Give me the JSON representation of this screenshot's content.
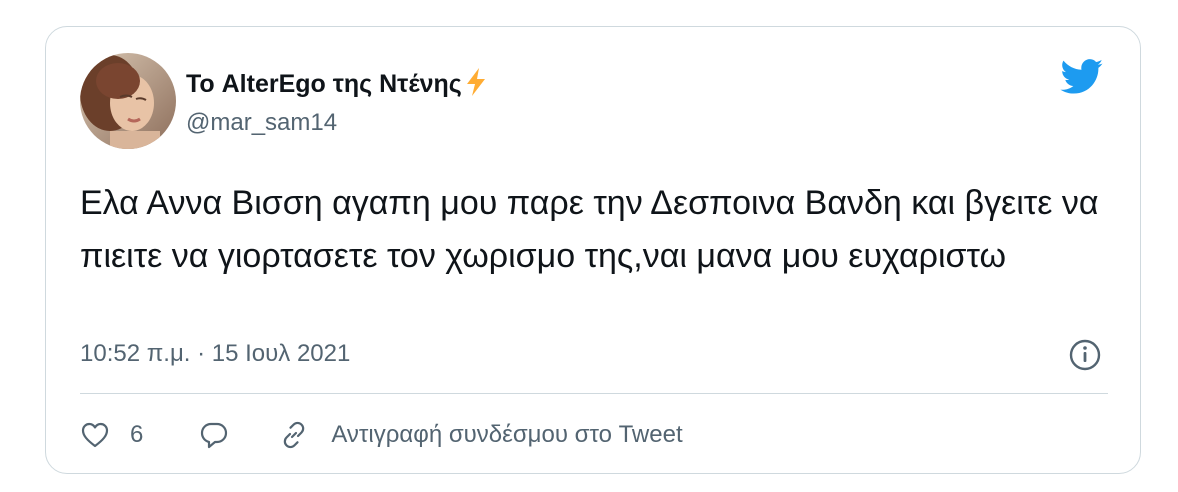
{
  "tweet": {
    "author_name": "Το AlterEgo της Ντένης",
    "handle": "@mar_sam14",
    "text": "Ελα Αννα Βισση αγαπη μου παρε την Δεσποινα Βανδη και βγειτε να πιειτε να γιορτασετε τον χωρισμο της,ναι μανα μου ευχαριστω",
    "timestamp": "10:52 π.μ. · 15 Ιουλ 2021",
    "like_count": "6",
    "copy_link_label": "Αντιγραφή συνδέσμου στο Tweet"
  },
  "icons": {
    "verified_emoji": "lightning-bolt-icon",
    "brand": "twitter-bird-icon",
    "info": "info-icon",
    "like": "heart-icon",
    "reply": "reply-icon",
    "copy_link": "link-icon"
  },
  "colors": {
    "brand_blue": "#1d9bf0",
    "text_primary": "#0f1419",
    "text_secondary": "#536471",
    "border": "#cfd9de",
    "bolt_yellow": "#ffac33"
  }
}
